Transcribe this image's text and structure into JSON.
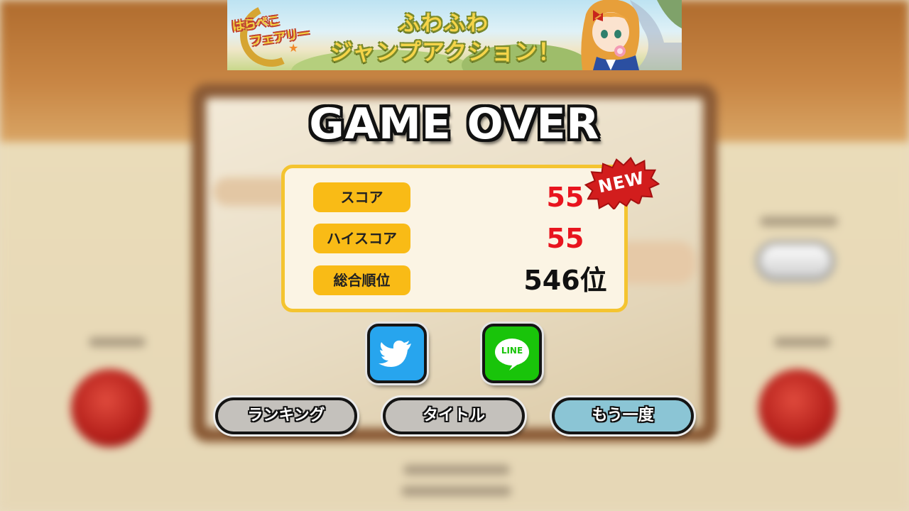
{
  "banner": {
    "logo_line1": "はらぺこ",
    "logo_line2": "フェアリー",
    "tagline_line1": "ふわふわ",
    "tagline_line2": "ジャンプアクション！"
  },
  "title": "GAME OVER",
  "badge": "NEW",
  "results": [
    {
      "label": "スコア",
      "value": "55",
      "color": "#e8141e"
    },
    {
      "label": "ハイスコア",
      "value": "55",
      "color": "#e8141e"
    },
    {
      "label": "総合順位",
      "value": "546位",
      "color": "#111111"
    }
  ],
  "share": {
    "twitter_icon": "twitter-bird-icon",
    "line_icon": "line-chat-icon",
    "line_text": "LINE"
  },
  "buttons": {
    "ranking": "ランキング",
    "title": "タイトル",
    "retry": "もう一度"
  }
}
